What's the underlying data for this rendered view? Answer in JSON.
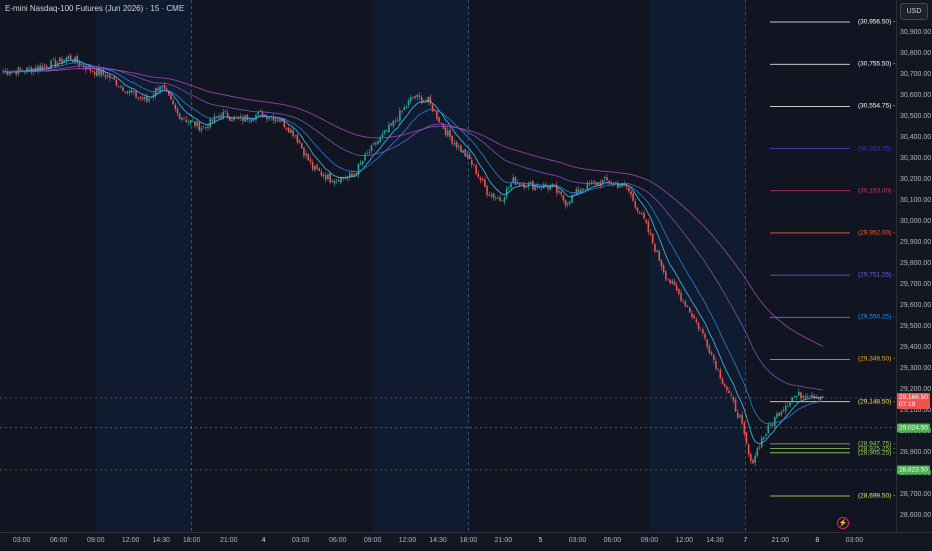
{
  "header": {
    "title": "E-mini Nasdaq-100 Futures (Jun 2026) · 15 · CME"
  },
  "price_axis": {
    "currency": "USD",
    "ticks": [
      "30,900.00",
      "30,800.00",
      "30,700.00",
      "30,600.00",
      "30,500.00",
      "30,400.00",
      "30,300.00",
      "30,200.00",
      "30,100.00",
      "30,000.00",
      "29,900.00",
      "29,800.00",
      "29,700.00",
      "29,600.00",
      "29,500.00",
      "29,400.00",
      "29,300.00",
      "29,200.00",
      "29,100.00",
      "29,000.00",
      "28,900.00",
      "28,800.00",
      "28,700.00",
      "28,600.00"
    ],
    "tick_values": [
      30900,
      30800,
      30700,
      30600,
      30500,
      30400,
      30300,
      30200,
      30100,
      30000,
      29900,
      29800,
      29700,
      29600,
      29500,
      29400,
      29300,
      29200,
      29100,
      29000,
      28900,
      28800,
      28700,
      28600
    ]
  },
  "time_axis": {
    "labels": [
      {
        "text": "03:00",
        "bar": 9,
        "bold": false
      },
      {
        "text": "06:00",
        "bar": 26,
        "bold": false
      },
      {
        "text": "09:00",
        "bar": 43,
        "bold": false
      },
      {
        "text": "12:00",
        "bar": 59,
        "bold": false
      },
      {
        "text": "14:30",
        "bar": 73,
        "bold": false
      },
      {
        "text": "18:00",
        "bar": 87,
        "bold": false
      },
      {
        "text": "21:00",
        "bar": 104,
        "bold": false
      },
      {
        "text": "4",
        "bar": 120,
        "bold": true
      },
      {
        "text": "03:00",
        "bar": 137,
        "bold": false
      },
      {
        "text": "06:00",
        "bar": 154,
        "bold": false
      },
      {
        "text": "09:00",
        "bar": 170,
        "bold": false
      },
      {
        "text": "12:00",
        "bar": 186,
        "bold": false
      },
      {
        "text": "14:30",
        "bar": 200,
        "bold": false
      },
      {
        "text": "18:00",
        "bar": 214,
        "bold": false
      },
      {
        "text": "21:00",
        "bar": 230,
        "bold": false
      },
      {
        "text": "5",
        "bar": 247,
        "bold": true
      },
      {
        "text": "03:00",
        "bar": 264,
        "bold": false
      },
      {
        "text": "06:00",
        "bar": 280,
        "bold": false
      },
      {
        "text": "09:00",
        "bar": 297,
        "bold": false
      },
      {
        "text": "12:00",
        "bar": 313,
        "bold": false
      },
      {
        "text": "14:30",
        "bar": 327,
        "bold": false
      },
      {
        "text": "7",
        "bar": 341,
        "bold": true
      },
      {
        "text": "21:00",
        "bar": 357,
        "bold": false
      },
      {
        "text": "8",
        "bar": 374,
        "bold": true
      },
      {
        "text": "03:00",
        "bar": 391,
        "bold": false
      }
    ]
  },
  "levels": [
    {
      "label": "(30,956.50)",
      "value": 30956.5,
      "color": "#ffffff"
    },
    {
      "label": "(30,755.50)",
      "value": 30755.5,
      "color": "#ffffff"
    },
    {
      "label": "(30,554.75)",
      "value": 30554.75,
      "color": "#ffffff"
    },
    {
      "label": "(30,353.75)",
      "value": 30353.75,
      "color": "#3d3dbf"
    },
    {
      "label": "(30,153.00)",
      "value": 30153,
      "color": "#d6336c"
    },
    {
      "label": "(29,952.00)",
      "value": 29952,
      "color": "#f0603c"
    },
    {
      "label": "(29,751.25)",
      "value": 29751.25,
      "color": "#7b5cd6"
    },
    {
      "label": "(29,550.25)",
      "value": 29550.25,
      "color": "#2f8fe0"
    },
    {
      "label": "(29,349.50)",
      "value": 29349.5,
      "color": "#f5a623"
    },
    {
      "label": "(29,148.50)",
      "value": 29148.5,
      "color": "#f5e663"
    },
    {
      "label": "(28,947.75)",
      "value": 28947.75,
      "color": "#9ccc65"
    },
    {
      "label": "(28,925.25)",
      "value": 28925.25,
      "color": "#9ccc65"
    },
    {
      "label": "(28,905.25)",
      "value": 28905.25,
      "color": "#9ccc65"
    },
    {
      "label": "(28,699.50)",
      "value": 28699.5,
      "color": "#f5e663"
    }
  ],
  "price_tags": [
    {
      "text": "29,166.50",
      "sub": "07:19",
      "value": 29166.5,
      "color": "#ef5350"
    },
    {
      "text": "29,024.50",
      "value": 29024.5,
      "color": "#4caf50"
    },
    {
      "text": "28,823.50",
      "value": 28823.5,
      "color": "#4caf50"
    }
  ],
  "colors": {
    "up": "#26a69a",
    "down": "#ef5350",
    "background": "#131722",
    "session": "#0f1f3d"
  },
  "icons": {
    "alert": "lightning-icon"
  },
  "candle_anchors": [
    [
      0,
      30720
    ],
    [
      12,
      30730
    ],
    [
      24,
      30760
    ],
    [
      30,
      30790
    ],
    [
      40,
      30730
    ],
    [
      48,
      30700
    ],
    [
      58,
      30620
    ],
    [
      66,
      30580
    ],
    [
      72,
      30660
    ],
    [
      80,
      30520
    ],
    [
      86,
      30480
    ],
    [
      92,
      30450
    ],
    [
      100,
      30520
    ],
    [
      108,
      30490
    ],
    [
      118,
      30520
    ],
    [
      126,
      30500
    ],
    [
      134,
      30420
    ],
    [
      142,
      30260
    ],
    [
      150,
      30210
    ],
    [
      160,
      30220
    ],
    [
      168,
      30340
    ],
    [
      178,
      30460
    ],
    [
      188,
      30600
    ],
    [
      195,
      30580
    ],
    [
      204,
      30420
    ],
    [
      214,
      30300
    ],
    [
      222,
      30150
    ],
    [
      228,
      30110
    ],
    [
      234,
      30200
    ],
    [
      242,
      30180
    ],
    [
      252,
      30170
    ],
    [
      258,
      30100
    ],
    [
      266,
      30170
    ],
    [
      276,
      30200
    ],
    [
      286,
      30170
    ],
    [
      294,
      30010
    ],
    [
      304,
      29750
    ],
    [
      314,
      29600
    ],
    [
      322,
      29450
    ],
    [
      330,
      29250
    ],
    [
      338,
      29070
    ],
    [
      343,
      28850
    ],
    [
      348,
      28970
    ],
    [
      356,
      29100
    ],
    [
      362,
      29170
    ],
    [
      370,
      29190
    ],
    [
      376,
      29170
    ]
  ]
}
